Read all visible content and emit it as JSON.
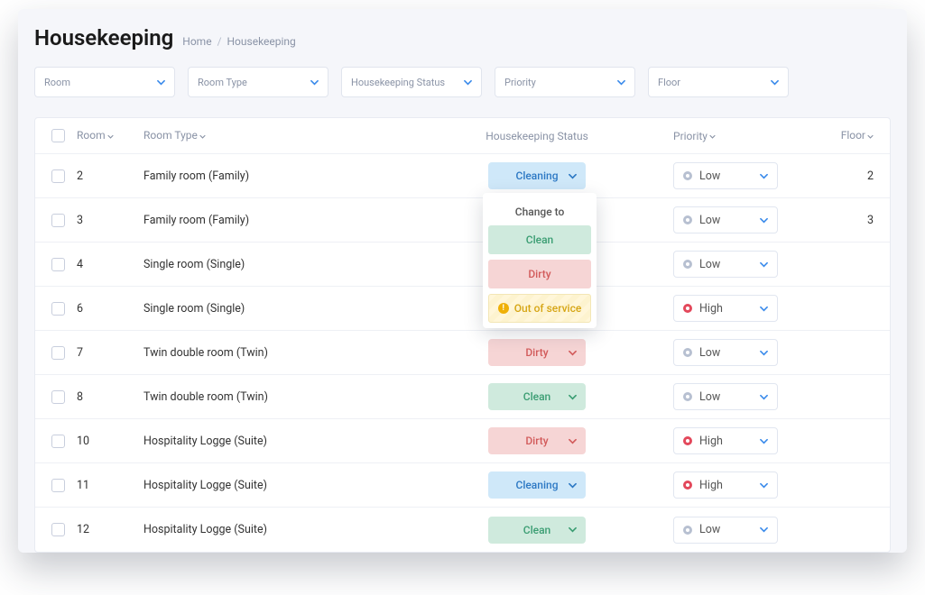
{
  "page_title": "Housekeeping",
  "breadcrumb": {
    "home": "Home",
    "current": "Housekeeping",
    "sep": "/"
  },
  "filters": [
    {
      "label": "Room"
    },
    {
      "label": "Room Type"
    },
    {
      "label": "Housekeeping Status"
    },
    {
      "label": "Priority"
    },
    {
      "label": "Floor"
    }
  ],
  "columns": {
    "room": "Room",
    "type": "Room Type",
    "status": "Housekeeping Status",
    "priority": "Priority",
    "floor": "Floor"
  },
  "status_labels": {
    "cleaning": "Cleaning",
    "clean": "Clean",
    "dirty": "Dirty"
  },
  "priority_labels": {
    "low": "Low",
    "high": "High"
  },
  "dropdown": {
    "title": "Change to",
    "options": {
      "clean": "Clean",
      "dirty": "Dirty",
      "oos": "Out of service"
    }
  },
  "rows": [
    {
      "room": "2",
      "type": "Family room (Family)",
      "status": "cleaning",
      "priority": "low",
      "floor": "2",
      "open": true
    },
    {
      "room": "3",
      "type": "Family room (Family)",
      "status": "",
      "priority": "low",
      "floor": "3"
    },
    {
      "room": "4",
      "type": "Single room (Single)",
      "status": "",
      "priority": "low",
      "floor": ""
    },
    {
      "room": "6",
      "type": "Single room (Single)",
      "status": "",
      "priority": "high",
      "floor": ""
    },
    {
      "room": "7",
      "type": "Twin double room (Twin)",
      "status": "dirty",
      "priority": "low",
      "floor": ""
    },
    {
      "room": "8",
      "type": "Twin double room (Twin)",
      "status": "clean",
      "priority": "low",
      "floor": ""
    },
    {
      "room": "10",
      "type": "Hospitality Logge (Suite)",
      "status": "dirty",
      "priority": "high",
      "floor": ""
    },
    {
      "room": "11",
      "type": "Hospitality Logge (Suite)",
      "status": "cleaning",
      "priority": "high",
      "floor": ""
    },
    {
      "room": "12",
      "type": "Hospitality Logge (Suite)",
      "status": "clean",
      "priority": "low",
      "floor": ""
    }
  ]
}
